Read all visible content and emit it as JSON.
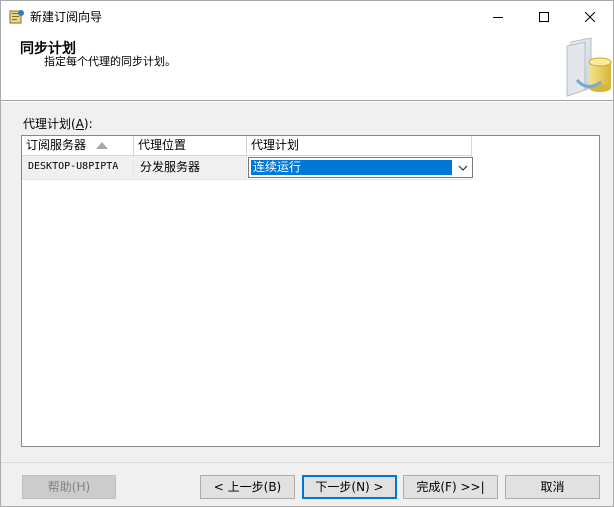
{
  "window": {
    "title": "新建订阅向导",
    "controls": {
      "minimize": "—",
      "maximize": "☐",
      "close": "✕"
    }
  },
  "header": {
    "title": "同步计划",
    "subtitle": "指定每个代理的同步计划。"
  },
  "grid": {
    "label": "代理计划(",
    "label_hotkey": "A",
    "label_suffix": "):",
    "columns": [
      "订阅服务器",
      "代理位置",
      "代理计划"
    ],
    "sorted_column": "订阅服务器",
    "rows": [
      {
        "subscriber": "DESKTOP-U8PIPTA",
        "location": "分发服务器",
        "schedule": "连续运行"
      }
    ]
  },
  "buttons": {
    "help": "帮助(H)",
    "prev": "< 上一步(B)",
    "next": "下一步(N) >",
    "finish": "完成(F) >>|",
    "cancel": "取消"
  },
  "colors": {
    "accent": "#0078d7",
    "header_bg": "#ffffff",
    "dialog_bg": "#f0f0f0"
  }
}
